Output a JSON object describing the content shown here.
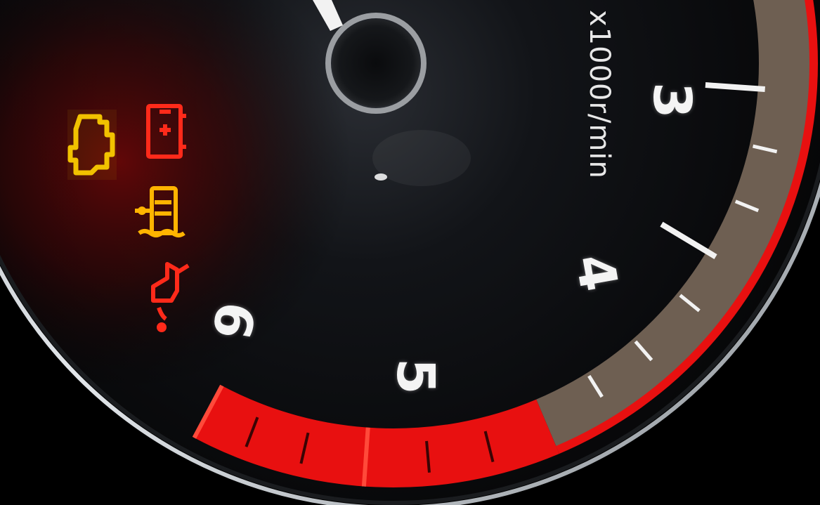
{
  "gauge": {
    "unit_label": "x1000r/min",
    "numerals": [
      "3",
      "4",
      "5",
      "6"
    ],
    "redline_color": "#e81010",
    "band_color": "#6e5f52",
    "needle_color": "#f2f2f2"
  },
  "warning_lights": [
    {
      "icon": "check-engine-icon",
      "color": "#f2c200"
    },
    {
      "icon": "battery-icon",
      "color": "#ff2a1a"
    },
    {
      "icon": "coolant-temperature-icon",
      "color": "#ffb400"
    },
    {
      "icon": "oil-pressure-icon",
      "color": "#ff2a1a"
    }
  ]
}
